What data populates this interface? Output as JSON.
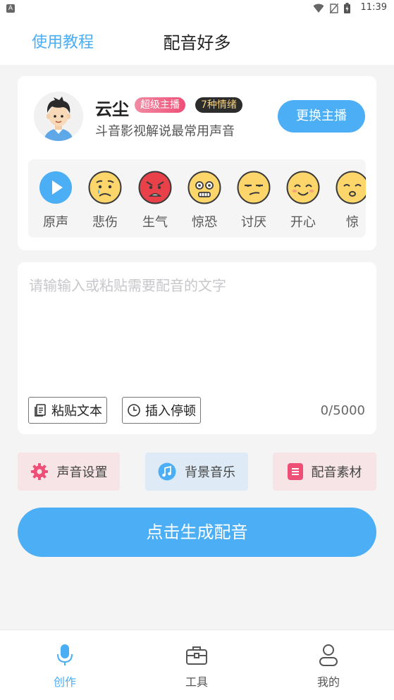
{
  "status_bar": {
    "app_badge": "A",
    "time": "11:39"
  },
  "header": {
    "tutorial": "使用教程",
    "title": "配音好多"
  },
  "anchor": {
    "name": "云尘",
    "badge_super": "超级主播",
    "badge_emotions": "7种情绪",
    "description": "斗音影视解说最常用声音",
    "change_button": "更换主播"
  },
  "emotions": [
    {
      "label": "原声",
      "icon": "play-icon"
    },
    {
      "label": "悲伤",
      "icon": "sad-face-icon"
    },
    {
      "label": "生气",
      "icon": "angry-face-icon"
    },
    {
      "label": "惊恐",
      "icon": "scared-face-icon"
    },
    {
      "label": "讨厌",
      "icon": "annoyed-face-icon"
    },
    {
      "label": "开心",
      "icon": "happy-face-icon"
    },
    {
      "label": "惊",
      "icon": "surprised-face-icon"
    }
  ],
  "editor": {
    "placeholder": "请输输入或粘贴需要配音的文字",
    "paste_button": "粘贴文本",
    "pause_button": "插入停顿",
    "char_count": "0/5000"
  },
  "functions": {
    "voice_settings": "声音设置",
    "background_music": "背景音乐",
    "material": "配音素材"
  },
  "generate_button": "点击生成配音",
  "tabs": [
    {
      "label": "创作",
      "icon": "microphone-icon",
      "active": true
    },
    {
      "label": "工具",
      "icon": "toolbox-icon",
      "active": false
    },
    {
      "label": "我的",
      "icon": "user-icon",
      "active": false
    }
  ],
  "colors": {
    "accent": "#4caff6",
    "pink": "#ee4f77",
    "emoji_yellow": "#fcd66a",
    "emoji_red": "#e8414a"
  }
}
